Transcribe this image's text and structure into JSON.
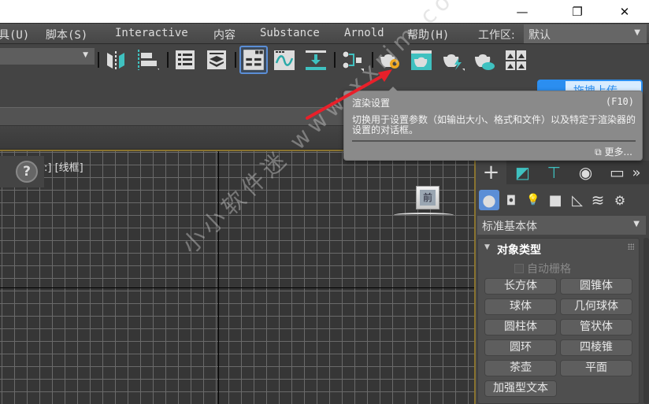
{
  "window": {
    "minimize_icon": "minimize-icon",
    "maximize_icon": "restore-icon",
    "close_icon": "close-icon",
    "minimize_glyph": "—",
    "restore_glyph": "❐",
    "close_glyph": "✕"
  },
  "menubar": {
    "items": [
      {
        "label": "工具(U)"
      },
      {
        "label": "脚本(S)"
      },
      {
        "label": "Interactive"
      },
      {
        "label": "内容"
      },
      {
        "label": "Substance"
      },
      {
        "label": "Arnold"
      },
      {
        "label": "帮助(H)"
      }
    ],
    "workspace_label": "工作区:",
    "workspace_value": "默认"
  },
  "toolbar": {
    "buttons": [
      {
        "icon": "mirror-icon"
      },
      {
        "icon": "align-icon"
      },
      {
        "icon": "scene-explorer-icon"
      },
      {
        "icon": "layer-explorer-icon"
      },
      {
        "icon": "ribbon-toggle-icon",
        "active": true
      },
      {
        "icon": "curve-editor-icon"
      },
      {
        "icon": "dope-sheet-icon"
      },
      {
        "icon": "schematic-view-icon"
      },
      {
        "icon": "render-setup-icon"
      },
      {
        "icon": "rendered-frame-window-icon"
      },
      {
        "icon": "render-production-icon"
      },
      {
        "icon": "render-cloud-icon"
      },
      {
        "icon": "material-editor-icon"
      }
    ]
  },
  "login_button": {
    "label": "拖拽上传",
    "icon": "user-icon"
  },
  "tooltip": {
    "title": "渲染设置",
    "shortcut": "(F10)",
    "description": "切换用于设置参数（如输出大小、格式和文件）以及特定于渲染器的设置的对话框。",
    "more_label": "更多...",
    "more_icon": "external-link-icon"
  },
  "viewport": {
    "label": ":] [线框]",
    "help_glyph": "?",
    "viewcube_face": "前",
    "watermark": "小小软件迷 www.xxrjm.com"
  },
  "command_panel": {
    "tabs": [
      {
        "icon": "create-icon",
        "glyph": "+"
      },
      {
        "icon": "modify-icon",
        "glyph": "◩"
      },
      {
        "icon": "hierarchy-icon",
        "glyph": "⊤"
      },
      {
        "icon": "motion-icon",
        "glyph": "◉"
      },
      {
        "icon": "display-icon",
        "glyph": "▭"
      },
      {
        "icon": "more-tabs-icon",
        "glyph": "»"
      }
    ],
    "categories": [
      {
        "icon": "geometry-icon",
        "glyph": "●"
      },
      {
        "icon": "shapes-icon",
        "glyph": "◘"
      },
      {
        "icon": "lights-icon",
        "glyph": "💡"
      },
      {
        "icon": "cameras-icon",
        "glyph": "■"
      },
      {
        "icon": "helpers-icon",
        "glyph": "◺"
      },
      {
        "icon": "space-warps-icon",
        "glyph": "≋"
      },
      {
        "icon": "systems-icon",
        "glyph": "⚙"
      }
    ],
    "type_select": "标准基本体",
    "rollout": {
      "title": "对象类型",
      "autogrid_label": "自动栅格",
      "buttons": [
        "长方体",
        "圆锥体",
        "球体",
        "几何球体",
        "圆柱体",
        "管状体",
        "圆环",
        "四棱锥",
        "茶壶",
        "平面",
        "加强型文本"
      ]
    }
  }
}
